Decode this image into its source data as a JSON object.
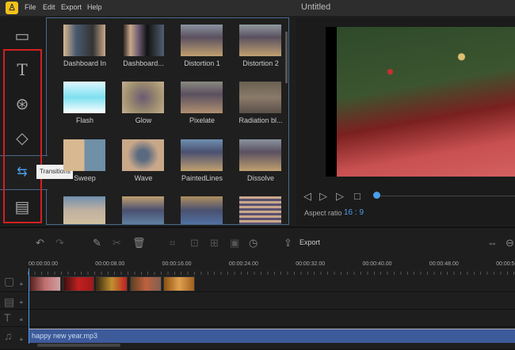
{
  "app": {
    "title": "Untitled",
    "menu": [
      "File",
      "Edit",
      "Export",
      "Help"
    ]
  },
  "sidebar": {
    "items": [
      {
        "icon": "media-icon"
      },
      {
        "icon": "text-icon"
      },
      {
        "icon": "filters-icon"
      },
      {
        "icon": "overlays-icon"
      },
      {
        "icon": "transitions-icon",
        "selected": true
      },
      {
        "icon": "elements-icon"
      }
    ],
    "tooltip": "Transitions"
  },
  "transitions": [
    {
      "label": "Dashboard In"
    },
    {
      "label": "Dashboard..."
    },
    {
      "label": "Distortion 1"
    },
    {
      "label": "Distortion 2"
    },
    {
      "label": "Flash"
    },
    {
      "label": "Glow"
    },
    {
      "label": "Pixelate"
    },
    {
      "label": "Radiation bl..."
    },
    {
      "label": "Sweep"
    },
    {
      "label": "Wave"
    },
    {
      "label": "PaintedLines"
    },
    {
      "label": "Dissolve"
    },
    {
      "label": ""
    },
    {
      "label": ""
    },
    {
      "label": ""
    },
    {
      "label": ""
    }
  ],
  "preview": {
    "aspect_label": "Aspect ratio",
    "aspect_value": "16 : 9",
    "progress": 0
  },
  "toolbar": {
    "export_label": "Export"
  },
  "timeline": {
    "ruler": [
      "00:00:00.00",
      "00:00:08.00",
      "00:00:16.00",
      "00:00:24.00",
      "00:00:32.00",
      "00:00:40.00",
      "00:00:48.00",
      "00:00:56"
    ],
    "audio_clip": "happy new year.mp3",
    "video_clips": 5
  },
  "colors": {
    "accent": "#4a9ee8",
    "highlight": "#d32020",
    "audio": "#3d5a9b"
  }
}
